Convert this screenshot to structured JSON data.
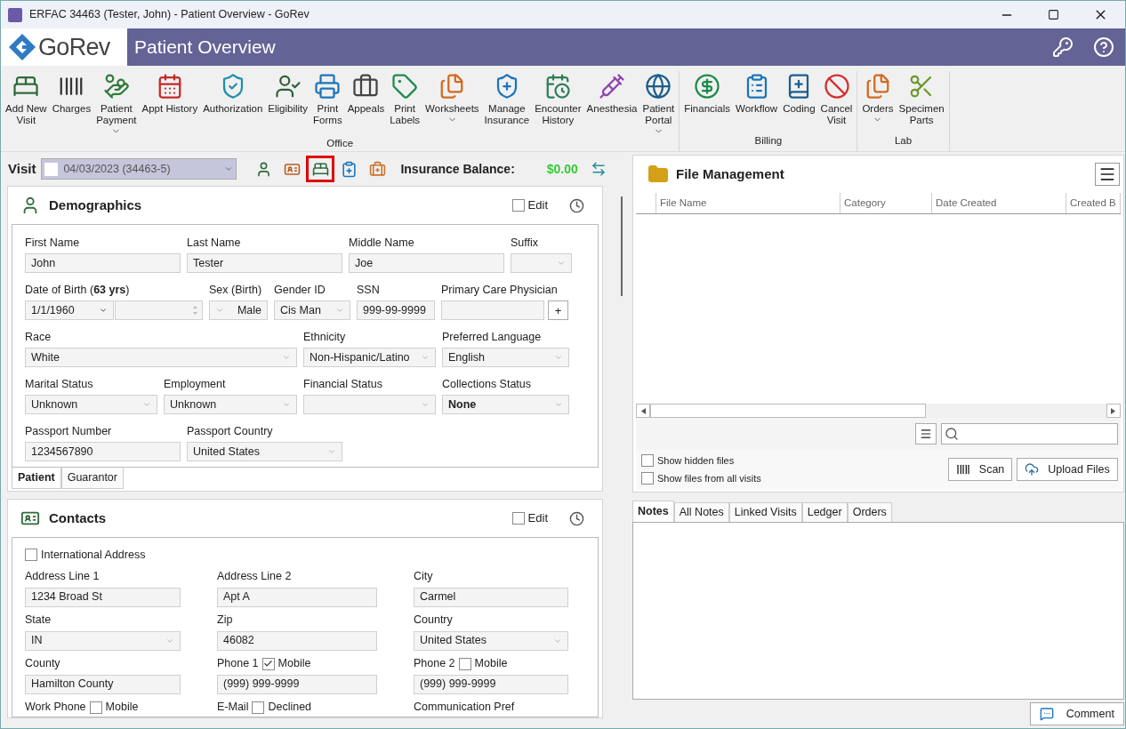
{
  "window": {
    "title": "ERFAC 34463 (Tester, John) - Patient Overview - GoRev"
  },
  "header": {
    "logo_text": "GoRev",
    "title": "Patient Overview"
  },
  "ribbon": {
    "groups": [
      {
        "label": "Office",
        "buttons": [
          {
            "lines": [
              "Add New",
              "Visit"
            ],
            "dropdown": false
          },
          {
            "lines": [
              "Charges"
            ],
            "dropdown": false
          },
          {
            "lines": [
              "Patient",
              "Payment"
            ],
            "dropdown": true
          },
          {
            "lines": [
              "Appt History"
            ],
            "dropdown": false
          },
          {
            "lines": [
              "Authorization"
            ],
            "dropdown": false
          },
          {
            "lines": [
              "Eligibility"
            ],
            "dropdown": false
          },
          {
            "lines": [
              "Print",
              "Forms"
            ],
            "dropdown": false
          },
          {
            "lines": [
              "Appeals"
            ],
            "dropdown": false
          },
          {
            "lines": [
              "Print",
              "Labels"
            ],
            "dropdown": false
          },
          {
            "lines": [
              "Worksheets"
            ],
            "dropdown": true
          },
          {
            "lines": [
              "Manage",
              "Insurance"
            ],
            "dropdown": false
          },
          {
            "lines": [
              "Encounter",
              "History"
            ],
            "dropdown": false
          },
          {
            "lines": [
              "Anesthesia"
            ],
            "dropdown": false
          },
          {
            "lines": [
              "Patient",
              "Portal"
            ],
            "dropdown": true
          }
        ]
      },
      {
        "label": "Billing",
        "buttons": [
          {
            "lines": [
              "Financials"
            ],
            "dropdown": false
          },
          {
            "lines": [
              "Workflow"
            ],
            "dropdown": false
          },
          {
            "lines": [
              "Coding"
            ],
            "dropdown": false
          },
          {
            "lines": [
              "Cancel",
              "Visit"
            ],
            "dropdown": false
          }
        ]
      },
      {
        "label": "Lab",
        "buttons": [
          {
            "lines": [
              "Orders"
            ],
            "dropdown": true
          },
          {
            "lines": [
              "Specimen",
              "Parts"
            ],
            "dropdown": false
          }
        ]
      }
    ]
  },
  "visit_bar": {
    "label": "Visit",
    "visit": "04/03/2023 (34463-5)",
    "tools": [
      {
        "selected": false
      },
      {
        "selected": false
      },
      {
        "selected": true
      },
      {
        "selected": false
      },
      {
        "selected": false
      }
    ],
    "balance_label": "Insurance Balance:",
    "balance": "$0.00"
  },
  "demographics": {
    "title": "Demographics",
    "edit": {
      "label": "Edit",
      "checked": false
    },
    "fields": [
      {
        "label": "First Name",
        "value": "John",
        "kind": "text"
      },
      {
        "label": "Last Name",
        "value": "Tester",
        "kind": "text"
      },
      {
        "label": "Middle Name",
        "value": "Joe",
        "kind": "text"
      },
      {
        "label": "Suffix",
        "kind": "select"
      },
      {
        "label": "Date of Birth (**63 yrs**)",
        "value": "1/1/1960",
        "kind": "date"
      },
      {
        "label": "Sex (Birth)",
        "value": "Male",
        "kind": "picker"
      },
      {
        "label": "Gender ID",
        "value": "Cis Man",
        "kind": "select"
      },
      {
        "label": "SSN",
        "value": "999-99-9999",
        "kind": "text"
      },
      {
        "label": "Primary Care Physician",
        "kind": "lookup",
        "button": "+"
      },
      {
        "label": "Race",
        "value": "White",
        "kind": "select"
      },
      {
        "label": "Ethnicity",
        "value": "Non-Hispanic/Latino",
        "kind": "select"
      },
      {
        "label": "Preferred Language",
        "value": "English",
        "kind": "select"
      },
      {
        "label": "Marital Status",
        "value": "Unknown",
        "kind": "select"
      },
      {
        "label": "Employment",
        "value": "Unknown",
        "kind": "select"
      },
      {
        "label": "Financial Status",
        "kind": "select"
      },
      {
        "label": "Collections Status",
        "value": "None",
        "kind": "select_bold"
      },
      {
        "label": "Passport Number",
        "value": "1234567890",
        "kind": "text"
      },
      {
        "label": "Passport Country",
        "value": "United States",
        "kind": "select"
      }
    ],
    "tabs": [
      {
        "label": "Patient",
        "selected": true
      },
      {
        "label": "Guarantor",
        "selected": false
      }
    ]
  },
  "contacts": {
    "title": "Contacts",
    "edit": {
      "label": "Edit",
      "checked": false
    },
    "international": {
      "label": "International Address",
      "checked": false
    },
    "rows": [
      [
        {
          "label": "Address Line 1",
          "value": "1234 Broad St",
          "kind": "text"
        },
        {
          "label": "Address Line 2",
          "value": "Apt A",
          "kind": "text"
        },
        {
          "label": "City",
          "value": "Carmel",
          "kind": "text"
        }
      ],
      [
        {
          "label": "State",
          "value": "IN",
          "kind": "select"
        },
        {
          "label": "Zip",
          "value": "46082",
          "kind": "text"
        },
        {
          "label": "Country",
          "value": "United States",
          "kind": "select"
        }
      ],
      [
        {
          "label": "County",
          "value": "Hamilton County",
          "kind": "text"
        },
        {
          "label": "Phone 1",
          "value": "(999) 999-9999",
          "kind": "text",
          "check": {
            "label": "Mobile",
            "checked": true
          }
        },
        {
          "label": "Phone 2",
          "value": "(999) 999-9999",
          "kind": "text",
          "check": {
            "label": "Mobile",
            "checked": false
          }
        }
      ],
      [
        {
          "label": "Work Phone",
          "kind": "label",
          "check": {
            "label": "Mobile",
            "checked": false
          }
        },
        {
          "label": "E-Mail",
          "kind": "label",
          "check": {
            "label": "Declined",
            "checked": false
          }
        },
        {
          "label": "Communication Pref",
          "kind": "label"
        }
      ]
    ]
  },
  "file_management": {
    "title": "File Management",
    "columns": [
      "File Name",
      "Category",
      "Date Created",
      "Created B"
    ],
    "options": [
      {
        "label": "Show hidden files",
        "checked": false
      },
      {
        "label": "Show files from all visits",
        "checked": false
      }
    ],
    "buttons": [
      "Scan",
      "Upload Files"
    ]
  },
  "notes": {
    "tabs": [
      {
        "label": "Notes",
        "selected": true
      },
      {
        "label": "All Notes",
        "selected": false
      },
      {
        "label": "Linked Visits",
        "selected": false
      },
      {
        "label": "Ledger",
        "selected": false
      },
      {
        "label": "Orders",
        "selected": false
      }
    ],
    "button": "Comment"
  }
}
